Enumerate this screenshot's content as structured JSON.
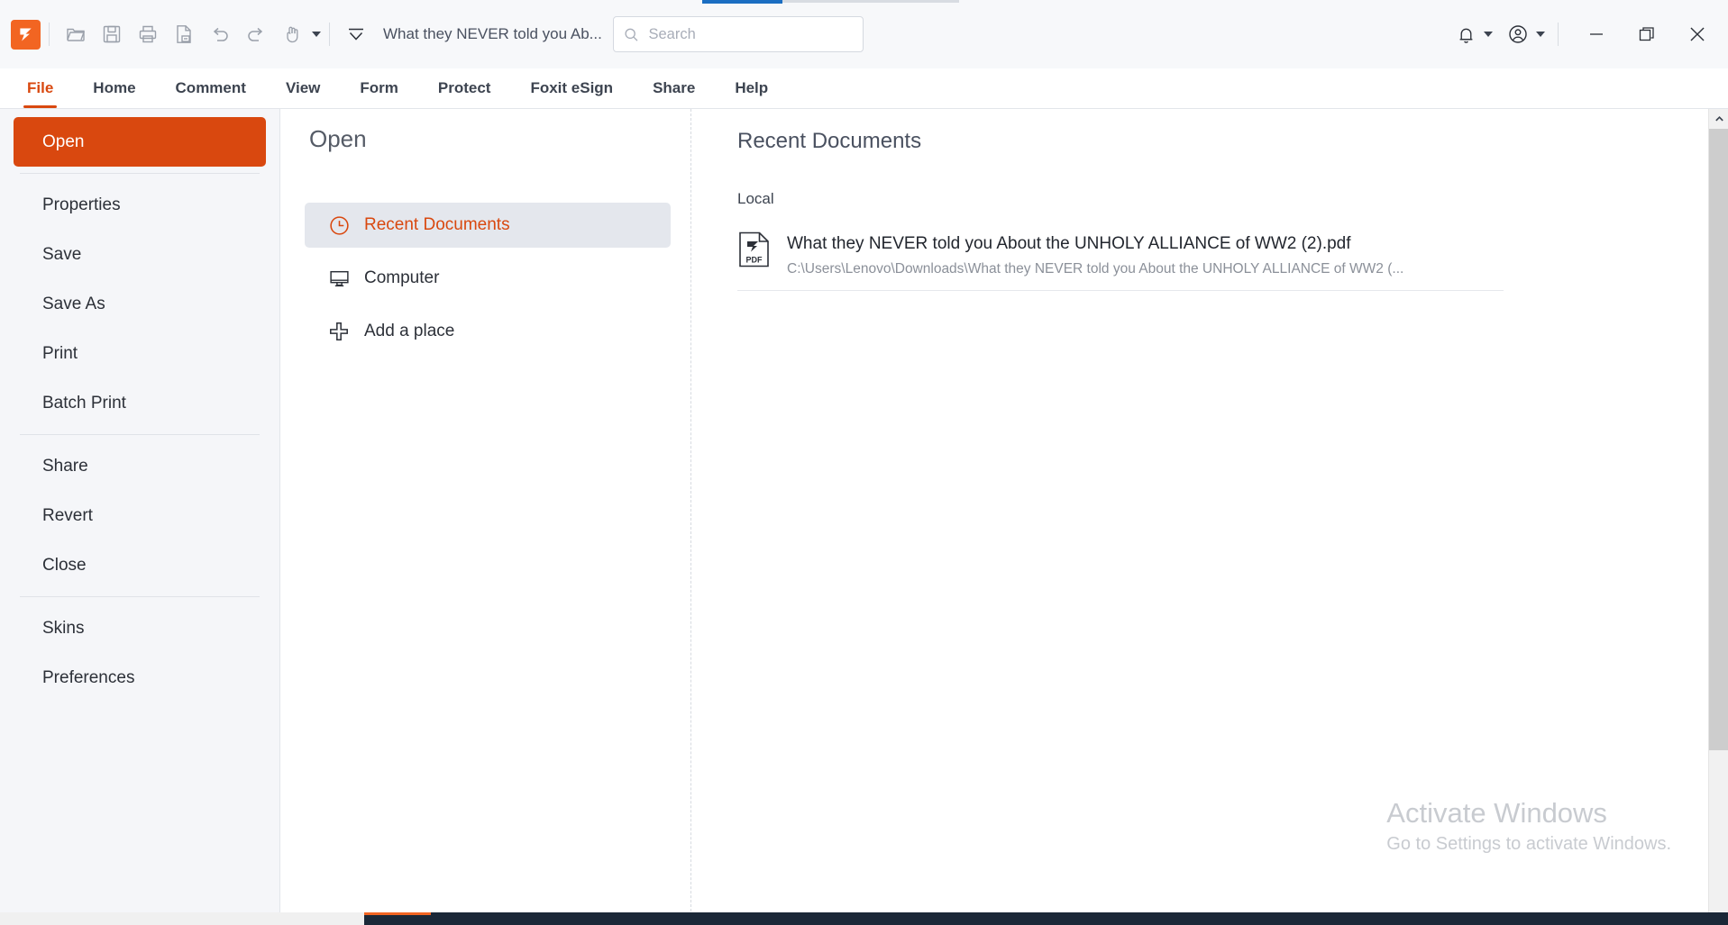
{
  "app": {
    "logo_icon": "foxit-logo-icon",
    "document_title": "What they NEVER told you Ab..."
  },
  "quick_toolbar": [
    {
      "name": "open-file-icon",
      "label": "Open"
    },
    {
      "name": "save-icon",
      "label": "Save"
    },
    {
      "name": "print-icon",
      "label": "Print"
    },
    {
      "name": "export-page-icon",
      "label": "Export"
    },
    {
      "name": "undo-icon",
      "label": "Undo"
    },
    {
      "name": "redo-icon",
      "label": "Redo"
    },
    {
      "name": "hand-tool-icon",
      "label": "Hand Tool"
    }
  ],
  "search": {
    "placeholder": "Search",
    "value": "",
    "icon": "search-icon"
  },
  "window_controls": {
    "notification_icon": "bell-icon",
    "account_icon": "user-account-icon",
    "minimize_icon": "minimize-icon",
    "restore_icon": "restore-icon",
    "close_icon": "close-icon"
  },
  "menubar": {
    "items": [
      {
        "label": "File",
        "active": true
      },
      {
        "label": "Home",
        "active": false
      },
      {
        "label": "Comment",
        "active": false
      },
      {
        "label": "View",
        "active": false
      },
      {
        "label": "Form",
        "active": false
      },
      {
        "label": "Protect",
        "active": false
      },
      {
        "label": "Foxit eSign",
        "active": false
      },
      {
        "label": "Share",
        "active": false
      },
      {
        "label": "Help",
        "active": false
      }
    ]
  },
  "sidebar": {
    "groups": [
      {
        "items": [
          {
            "label": "Open",
            "selected": true
          }
        ]
      },
      {
        "items": [
          {
            "label": "Properties",
            "selected": false
          },
          {
            "label": "Save",
            "selected": false
          },
          {
            "label": "Save As",
            "selected": false
          },
          {
            "label": "Print",
            "selected": false
          },
          {
            "label": "Batch Print",
            "selected": false
          }
        ]
      },
      {
        "items": [
          {
            "label": "Share",
            "selected": false
          },
          {
            "label": "Revert",
            "selected": false
          },
          {
            "label": "Close",
            "selected": false
          }
        ]
      },
      {
        "items": [
          {
            "label": "Skins",
            "selected": false
          },
          {
            "label": "Preferences",
            "selected": false
          }
        ]
      }
    ]
  },
  "open_panel": {
    "title": "Open",
    "items": [
      {
        "label": "Recent Documents",
        "icon": "clock-icon",
        "selected": true
      },
      {
        "label": "Computer",
        "icon": "monitor-icon",
        "selected": false
      },
      {
        "label": "Add a place",
        "icon": "plus-icon",
        "selected": false
      }
    ]
  },
  "recent_panel": {
    "title": "Recent Documents",
    "group_label": "Local",
    "documents": [
      {
        "name": "What they NEVER told you About the UNHOLY ALLIANCE of WW2 (2).pdf",
        "path": "C:\\Users\\Lenovo\\Downloads\\What they NEVER told you About the UNHOLY ALLIANCE of WW2 (...",
        "icon": "pdf-file-icon"
      }
    ]
  },
  "watermark": {
    "title": "Activate Windows",
    "subtitle": "Go to Settings to activate Windows."
  },
  "colors": {
    "accent_orange": "#d9480f",
    "logo_orange": "#f26522",
    "sidebar_bg": "#f5f6f9",
    "selected_bg": "#e4e7ed",
    "text_dark": "#2c3038"
  }
}
